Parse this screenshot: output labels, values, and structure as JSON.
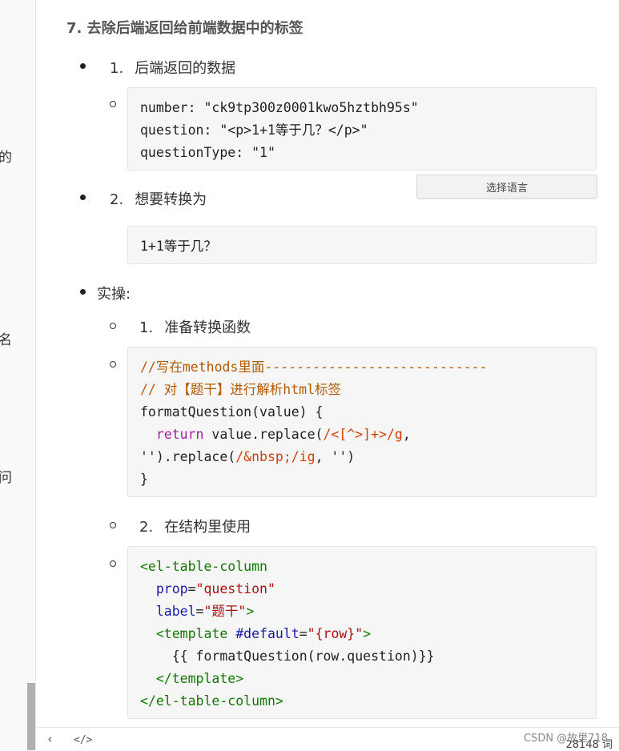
{
  "left_fragments": [
    "的",
    "名",
    "问"
  ],
  "heading": "7. 去除后端返回给前端数据中的标签",
  "items": {
    "i1": {
      "num": "1.",
      "label": "后端返回的数据"
    },
    "i2": {
      "num": "2.",
      "label": "想要转换为"
    },
    "practice": "实操:",
    "sub1": {
      "num": "1.",
      "label": "准备转换函数"
    },
    "sub2": {
      "num": "2.",
      "label": "在结构里使用"
    }
  },
  "code1": {
    "l1": "number: \"ck9tp300z0001kwo5hztbh95s\"",
    "l2": "question: \"<p>1+1等于几？</p>\"",
    "l3": "questionType: \"1\""
  },
  "code2": {
    "l1": "1+1等于几？"
  },
  "code3": {
    "comment1": "//写在methods里面----------------------------",
    "comment2": "// 对【题干】进行解析html标签",
    "l3": "formatQuestion(value) {",
    "l4_indent": "  ",
    "l4_kw": "return",
    "l4_mid": " value.replace(",
    "l4_re": "/<[^>]+>/g",
    "l4_end": ",",
    "l5_a": "'').replace(",
    "l5_re": "/&nbsp;/ig",
    "l5_b": ", '')",
    "l6": "}"
  },
  "code4": {
    "l1_tag": "<el-table-column",
    "l2_attr": "prop",
    "l2_eq": "=",
    "l2_val": "\"question\"",
    "l3_attr": "label",
    "l3_eq": "=",
    "l3_val": "\"题干\"",
    "l3_close": ">",
    "l4_tag": "<template",
    "l4_attr": "#default",
    "l4_eq": "=",
    "l4_val": "\"{row}\"",
    "l4_close": ">",
    "l5": "{{ formatQuestion(row.question)}}",
    "l6_tag": "</template>",
    "l7_tag": "</el-table-column>"
  },
  "lang_button": "选择语言",
  "statusbar": {
    "back_icon": "chevron-left-icon",
    "code_icon": "code-icon",
    "word_count": "28148 词"
  },
  "watermark": "CSDN @故里718"
}
